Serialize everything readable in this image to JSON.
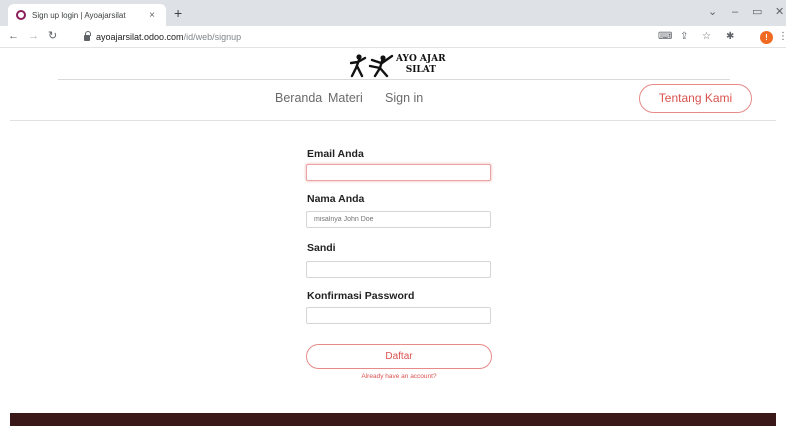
{
  "browser": {
    "tab_title": "Sign up login | Ayoajarsilat",
    "tab_close": "×",
    "new_tab": "+",
    "url_host": "ayoajarsilat.odoo.com",
    "url_path": "/id/web/signup",
    "profile_initial": "!"
  },
  "site": {
    "logo_line1": "AYO AJAR",
    "logo_line2": "SILAT",
    "menu": [
      "Beranda",
      "Materi",
      "Sign in"
    ],
    "cta": "Tentang Kami"
  },
  "form": {
    "email_label": "Email Anda",
    "email_value": "",
    "name_label": "Nama Anda",
    "name_placeholder": "misalnya John Doe",
    "password_label": "Sandi",
    "password_value": "",
    "confirm_label": "Konfirmasi Password",
    "confirm_value": "",
    "submit_label": "Daftar",
    "login_link": "Already have an account?"
  },
  "colors": {
    "accent": "#d9534f",
    "footer": "#3a1719",
    "favicon": "#8b1e5a"
  }
}
